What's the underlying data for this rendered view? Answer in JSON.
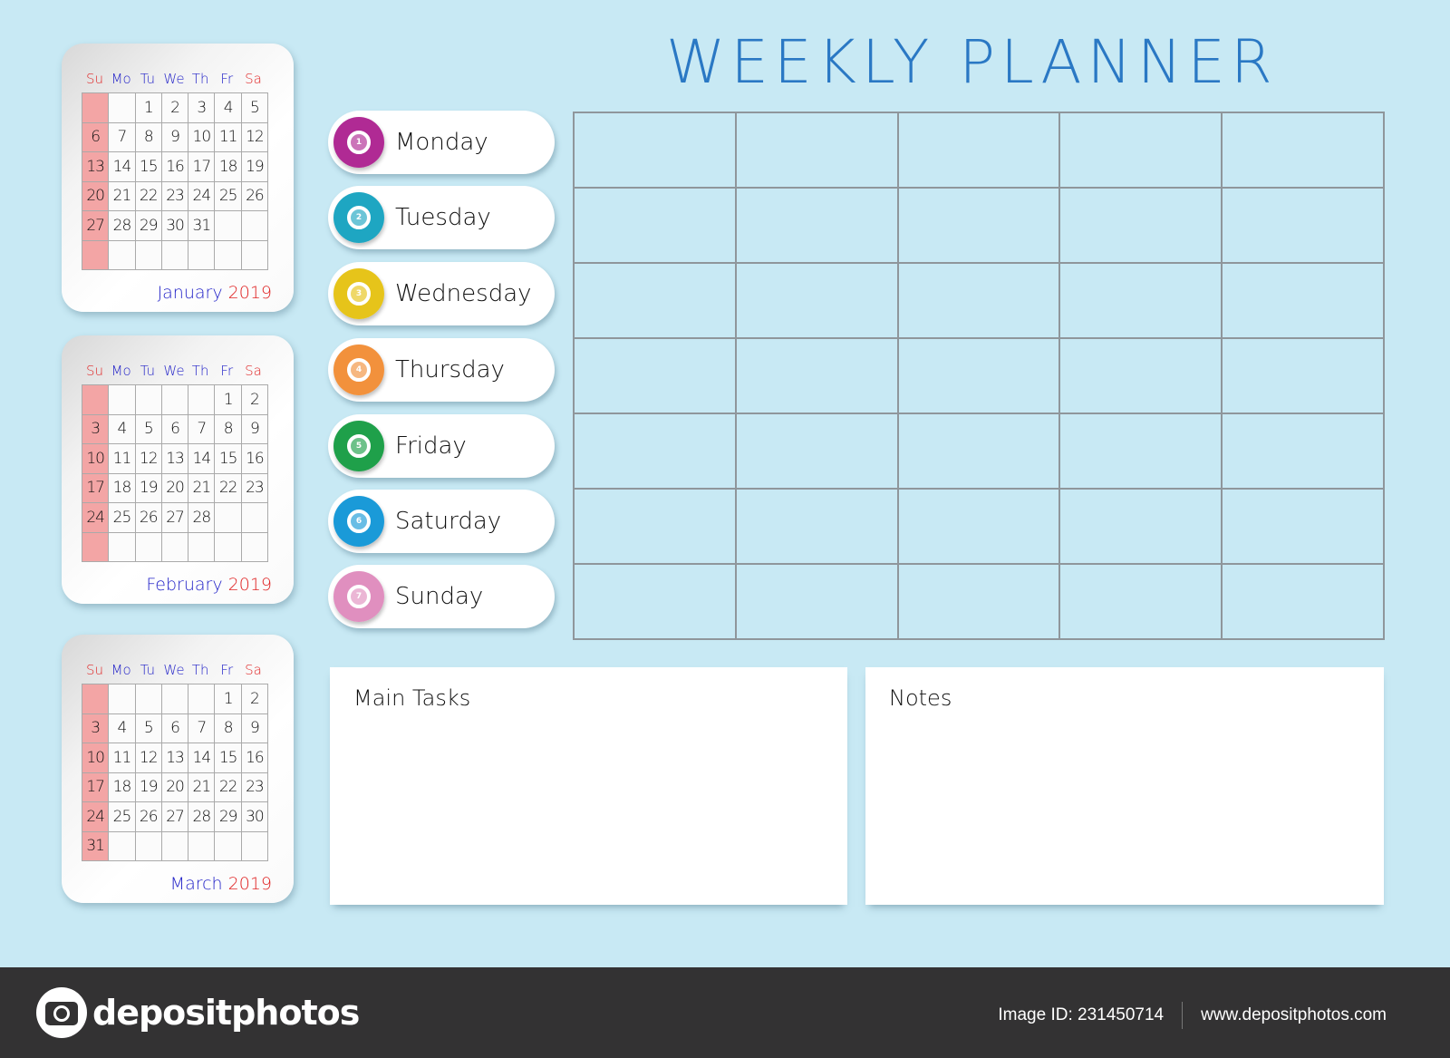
{
  "title": "WEEKLY PLANNER",
  "colors": {
    "background": "#c8e9f4",
    "title": "#2a78c4",
    "weekday_header": "#2323c8",
    "weekend_header": "#e02525",
    "sunday_column": "#f3a5a5",
    "grid_line": "#8f969b",
    "footer": "#333233"
  },
  "weekday_headers": [
    "Su",
    "Mo",
    "Tu",
    "We",
    "Th",
    "Fr",
    "Sa"
  ],
  "mini_calendars": [
    {
      "month": "January",
      "year": "2019",
      "weeks": [
        [
          "",
          "",
          "1",
          "2",
          "3",
          "4",
          "5"
        ],
        [
          "6",
          "7",
          "8",
          "9",
          "10",
          "11",
          "12"
        ],
        [
          "13",
          "14",
          "15",
          "16",
          "17",
          "18",
          "19"
        ],
        [
          "20",
          "21",
          "22",
          "23",
          "24",
          "25",
          "26"
        ],
        [
          "27",
          "28",
          "29",
          "30",
          "31",
          "",
          ""
        ],
        [
          "",
          "",
          "",
          "",
          "",
          "",
          ""
        ]
      ]
    },
    {
      "month": "February",
      "year": "2019",
      "weeks": [
        [
          "",
          "",
          "",
          "",
          "",
          "1",
          "2"
        ],
        [
          "3",
          "4",
          "5",
          "6",
          "7",
          "8",
          "9"
        ],
        [
          "10",
          "11",
          "12",
          "13",
          "14",
          "15",
          "16"
        ],
        [
          "17",
          "18",
          "19",
          "20",
          "21",
          "22",
          "23"
        ],
        [
          "24",
          "25",
          "26",
          "27",
          "28",
          "",
          ""
        ],
        [
          "",
          "",
          "",
          "",
          "",
          "",
          ""
        ]
      ]
    },
    {
      "month": "March",
      "year": "2019",
      "weeks": [
        [
          "",
          "",
          "",
          "",
          "",
          "1",
          "2"
        ],
        [
          "3",
          "4",
          "5",
          "6",
          "7",
          "8",
          "9"
        ],
        [
          "10",
          "11",
          "12",
          "13",
          "14",
          "15",
          "16"
        ],
        [
          "17",
          "18",
          "19",
          "20",
          "21",
          "22",
          "23"
        ],
        [
          "24",
          "25",
          "26",
          "27",
          "28",
          "29",
          "30"
        ],
        [
          "31",
          "",
          "",
          "",
          "",
          "",
          ""
        ]
      ]
    }
  ],
  "days": [
    {
      "label": "Monday",
      "number": "1",
      "color": "#b02a94"
    },
    {
      "label": "Tuesday",
      "number": "2",
      "color": "#1ea6c2"
    },
    {
      "label": "Wednesday",
      "number": "3",
      "color": "#e6c41a"
    },
    {
      "label": "Thursday",
      "number": "4",
      "color": "#f2913c"
    },
    {
      "label": "Friday",
      "number": "5",
      "color": "#1fa04a"
    },
    {
      "label": "Saturday",
      "number": "6",
      "color": "#1a9ad8"
    },
    {
      "label": "Sunday",
      "number": "7",
      "color": "#e08fbf"
    }
  ],
  "grid": {
    "rows": 7,
    "columns": 5
  },
  "boxes": {
    "main_tasks": "Main Tasks",
    "notes": "Notes"
  },
  "footer": {
    "brand": "depositphotos",
    "image_id": "Image ID: 231450714",
    "url": "www.depositphotos.com"
  }
}
